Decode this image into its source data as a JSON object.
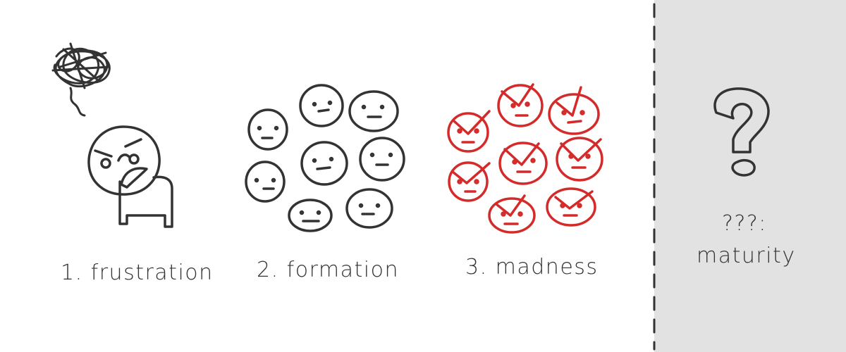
{
  "stages": [
    {
      "label": "1. frustration"
    },
    {
      "label": "2. formation"
    },
    {
      "label": "3. madness"
    }
  ],
  "maturity": {
    "mark_label": "???:",
    "label": "maturity"
  },
  "colors": {
    "ink": "#333333",
    "red": "#d42a2a",
    "panel": "#e2e2e2",
    "background": "#ffffff"
  },
  "icons": [
    "scribble-cloud-icon",
    "angry-person-icon",
    "neutral-face-icon",
    "angry-face-icon",
    "question-mark-icon"
  ]
}
